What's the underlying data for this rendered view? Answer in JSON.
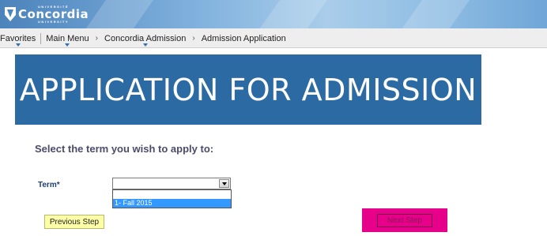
{
  "header": {
    "brand_small_top": "UNIVERSITÉ",
    "brand_name": "Concordia",
    "brand_small_bottom": "UNIVERSITY"
  },
  "nav": {
    "favorites": "Favorites",
    "main_menu": "Main Menu",
    "crumb_1": "Concordia Admission",
    "crumb_2": "Admission Application",
    "separator": "›"
  },
  "banner": {
    "title": "APPLICATION FOR ADMISSION"
  },
  "form": {
    "prompt": "Select the term you wish to apply to:",
    "term_label": "Term*",
    "term_value": "",
    "options": [
      "",
      "1- Fall 2015"
    ],
    "highlighted_option": "1- Fall 2015"
  },
  "buttons": {
    "previous": "Previous Step",
    "next": "Next Step"
  },
  "colors": {
    "banner": "#2b6aa3",
    "next_button": "#e6008a",
    "previous_button": "#ffffa8",
    "highlight": "#3399ff"
  }
}
